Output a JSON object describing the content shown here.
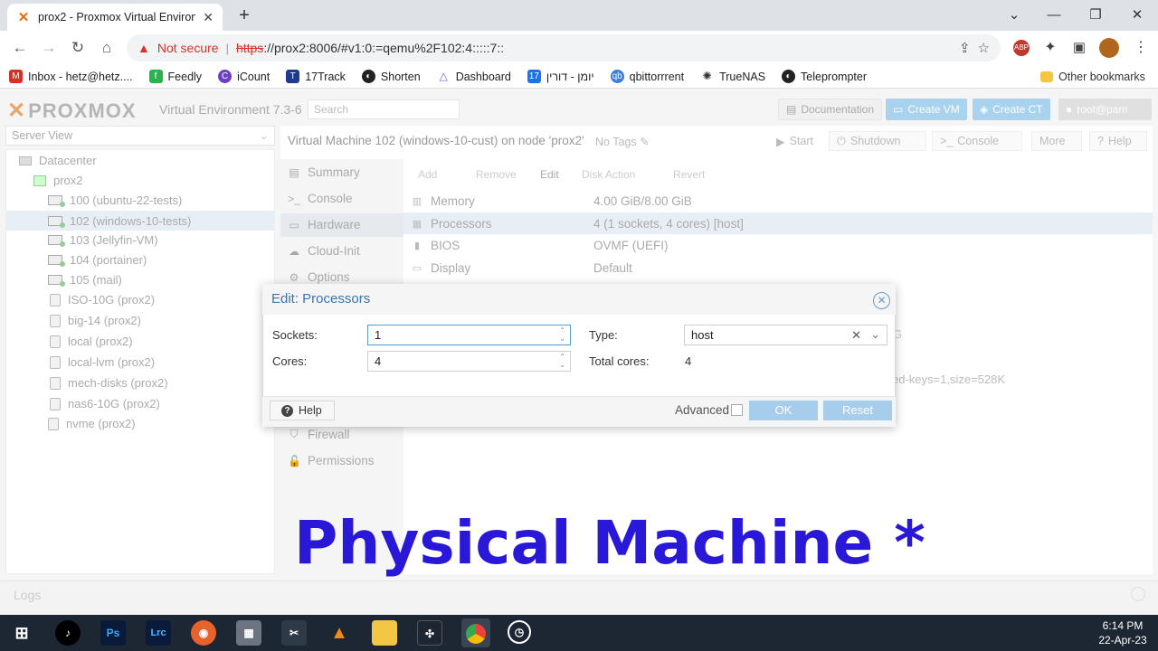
{
  "browser": {
    "tab_title": "prox2 - Proxmox Virtual Environm",
    "not_secure": "Not secure",
    "url_scheme": "https",
    "url_rest": "://prox2:8006/#v1:0:=qemu%2F102:4:::::7::",
    "bookmarks": [
      {
        "label": "Inbox - hetz@hetz....",
        "color": "#d93025",
        "icon": "gmail-icon"
      },
      {
        "label": "Feedly",
        "color": "#2bb24c",
        "icon": "feedly-icon"
      },
      {
        "label": "iCount",
        "color": "#6c3fc5",
        "icon": "icount-icon"
      },
      {
        "label": "17Track",
        "color": "#1f3a8a",
        "icon": "17track-icon"
      },
      {
        "label": "Shorten",
        "color": "#222222",
        "icon": "globe-icon"
      },
      {
        "label": "Dashboard",
        "color": "#7b5cd6",
        "icon": "dashboard-icon"
      },
      {
        "label": "יומן - דורין",
        "color": "#1a73e8",
        "icon": "calendar-icon"
      },
      {
        "label": "qbittorrrent",
        "color": "#3b7dd8",
        "icon": "qbittorrent-icon"
      },
      {
        "label": "TrueNAS",
        "color": "#333333",
        "icon": "truenas-icon"
      },
      {
        "label": "Teleprompter",
        "color": "#222222",
        "icon": "globe-icon"
      }
    ],
    "other_bookmarks": "Other bookmarks"
  },
  "pve": {
    "logo": "PROXMOX",
    "product": "Virtual Environment 7.3-6",
    "search_placeholder": "Search",
    "documentation": "Documentation",
    "create_vm": "Create VM",
    "create_ct": "Create CT",
    "user": "root@pam",
    "server_view": "Server View",
    "tree": [
      {
        "label": "Datacenter",
        "type": "dc"
      },
      {
        "label": "prox2",
        "type": "srv"
      },
      {
        "label": "100 (ubuntu-22-tests)",
        "type": "vm"
      },
      {
        "label": "102 (windows-10-tests)",
        "type": "vm"
      },
      {
        "label": "103 (Jellyfin-VM)",
        "type": "vm"
      },
      {
        "label": "104 (portainer)",
        "type": "vm"
      },
      {
        "label": "105 (mail)",
        "type": "vm"
      },
      {
        "label": "ISO-10G (prox2)",
        "type": "st"
      },
      {
        "label": "big-14 (prox2)",
        "type": "st"
      },
      {
        "label": "local (prox2)",
        "type": "st"
      },
      {
        "label": "local-lvm (prox2)",
        "type": "st"
      },
      {
        "label": "mech-disks (prox2)",
        "type": "st"
      },
      {
        "label": "nas6-10G (prox2)",
        "type": "st"
      },
      {
        "label": "nvme (prox2)",
        "type": "st"
      }
    ],
    "vm_title": "Virtual Machine 102 (windows-10-cust) on node 'prox2'",
    "no_tags": "No Tags",
    "toolbar": {
      "start": "Start",
      "shutdown": "Shutdown",
      "console": "Console",
      "more": "More",
      "help": "Help"
    },
    "nav": [
      "Summary",
      "Console",
      "Hardware",
      "Cloud-Init",
      "Options",
      "Firewall",
      "Permissions"
    ],
    "hw_toolbar": [
      "Add",
      "Remove",
      "Edit",
      "Disk Action",
      "Revert"
    ],
    "hardware": [
      {
        "key": "Memory",
        "value": "4.00 GiB/8.00 GiB"
      },
      {
        "key": "Processors",
        "value": "4 (1 sockets, 4 cores) [host]"
      },
      {
        "key": "BIOS",
        "value": "OVMF (UEFI)"
      },
      {
        "key": "Display",
        "value": "Default"
      }
    ],
    "bg_efi": "ed-keys=1,size=528K",
    "bg_g": "G",
    "logs": "Logs"
  },
  "dialog": {
    "title": "Edit: Processors",
    "sockets_label": "Sockets:",
    "sockets_value": "1",
    "cores_label": "Cores:",
    "cores_value": "4",
    "type_label": "Type:",
    "type_value": "host",
    "total_label": "Total cores:",
    "total_value": "4",
    "help": "Help",
    "advanced": "Advanced",
    "ok": "OK",
    "reset": "Reset"
  },
  "caption": "Physical Machine *",
  "taskbar": {
    "time": "6:14 PM",
    "date": "22-Apr-23"
  }
}
